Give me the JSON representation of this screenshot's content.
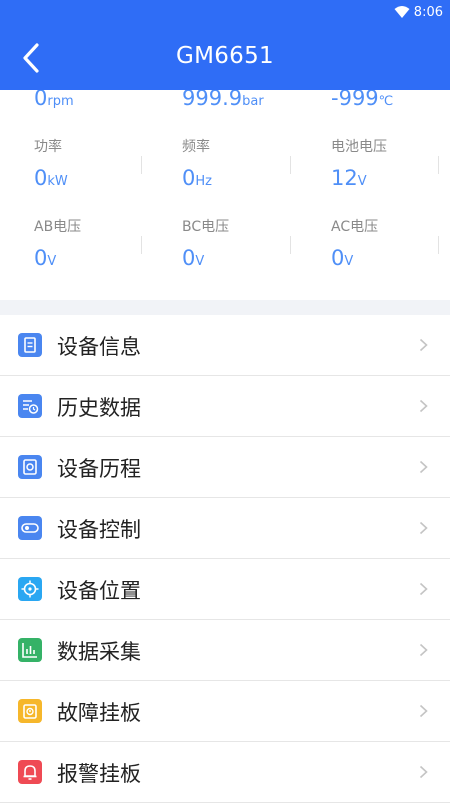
{
  "status_bar": {
    "time": "8:06"
  },
  "header": {
    "title": "GM6651"
  },
  "stats": {
    "row0": [
      {
        "value": "0",
        "unit": "rpm"
      },
      {
        "value": "999.9",
        "unit": "bar"
      },
      {
        "value": "-999",
        "unit": "℃"
      }
    ],
    "row1": [
      {
        "label": "功率",
        "value": "0",
        "unit": "kW"
      },
      {
        "label": "频率",
        "value": "0",
        "unit": "Hz"
      },
      {
        "label": "电池电压",
        "value": "12",
        "unit": "V"
      }
    ],
    "row2": [
      {
        "label": "AB电压",
        "value": "0",
        "unit": "V"
      },
      {
        "label": "BC电压",
        "value": "0",
        "unit": "V"
      },
      {
        "label": "AC电压",
        "value": "0",
        "unit": "V"
      }
    ]
  },
  "menu": {
    "items": [
      {
        "label": "设备信息",
        "icon": "info-doc-icon",
        "color": "#4a86f0"
      },
      {
        "label": "历史数据",
        "icon": "history-icon",
        "color": "#4a86f0"
      },
      {
        "label": "设备历程",
        "icon": "record-icon",
        "color": "#4a86f0"
      },
      {
        "label": "设备控制",
        "icon": "control-icon",
        "color": "#4a86f0"
      },
      {
        "label": "设备位置",
        "icon": "location-icon",
        "color": "#2aa7f2"
      },
      {
        "label": "数据采集",
        "icon": "chart-icon",
        "color": "#35b267"
      },
      {
        "label": "故障挂板",
        "icon": "fault-icon",
        "color": "#f6b72b"
      },
      {
        "label": "报警挂板",
        "icon": "alarm-icon",
        "color": "#ef4a54"
      }
    ]
  }
}
